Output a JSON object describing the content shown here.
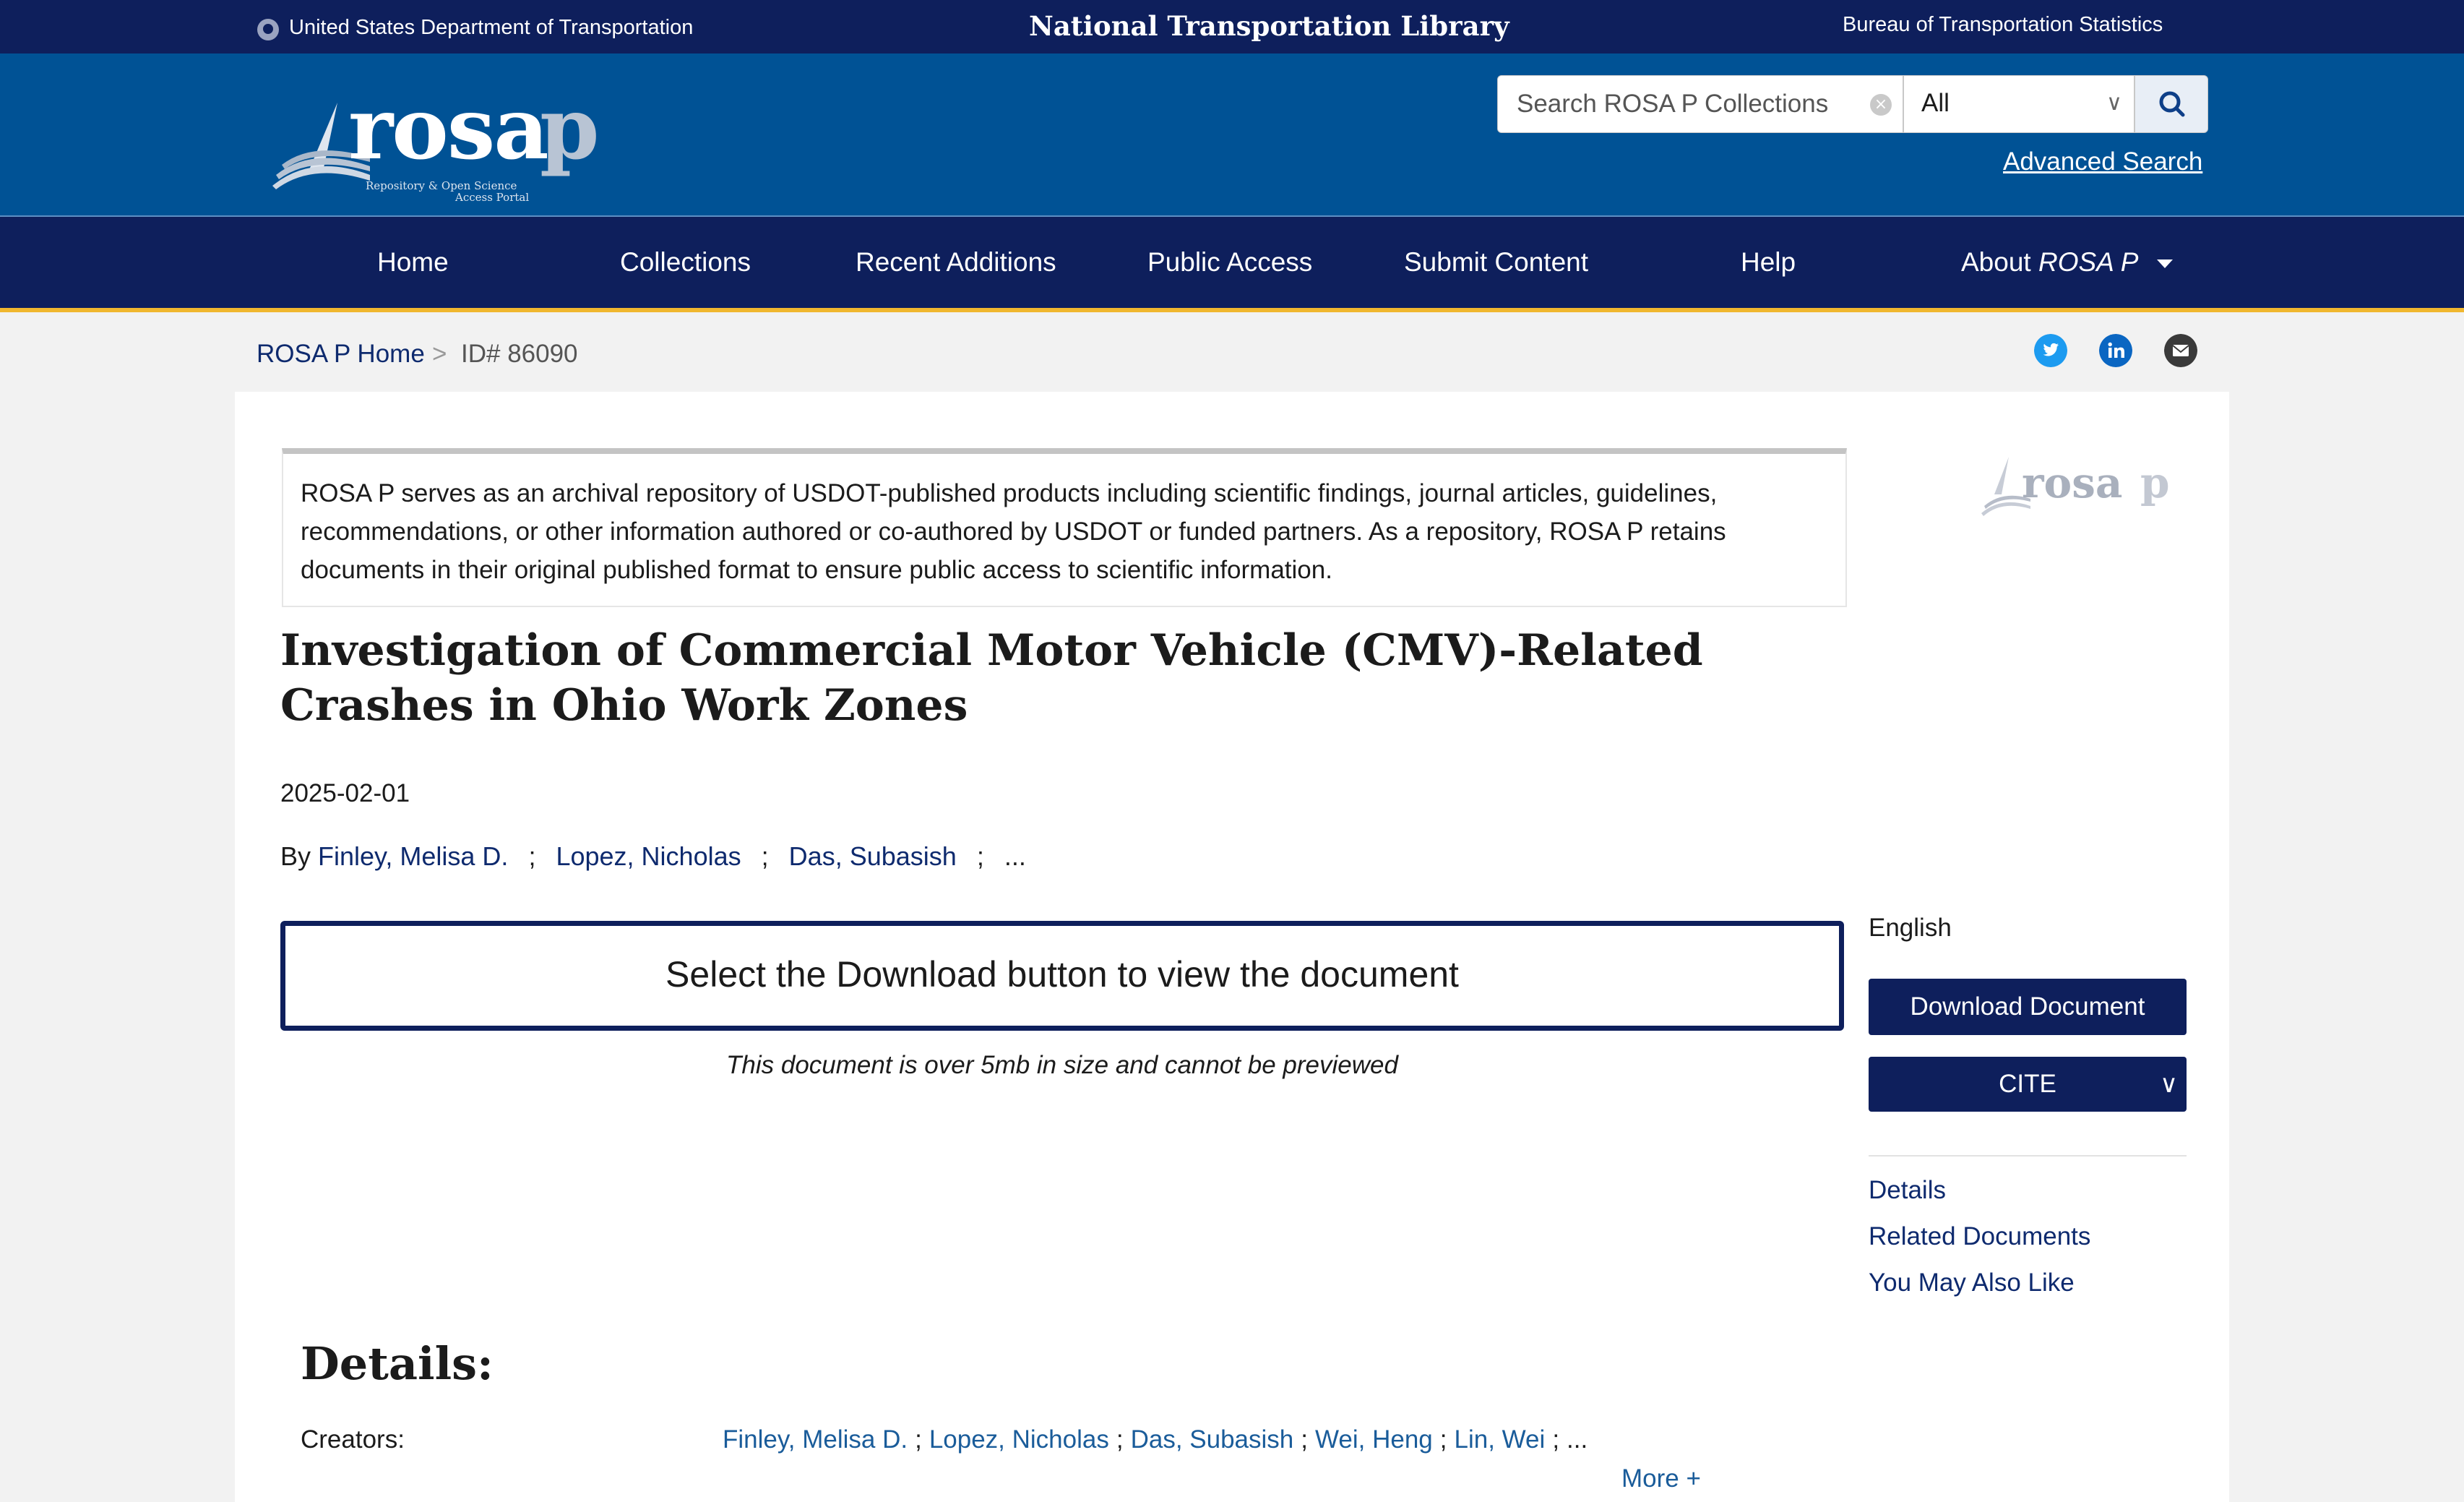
{
  "topbar": {
    "department": "United States Department of Transportation",
    "library": "National Transportation Library",
    "bureau": "Bureau of Transportation Statistics"
  },
  "logo": {
    "main": "rosa",
    "letter": "p",
    "sub_line1": "Repository & Open Science",
    "sub_line2": "Access Portal"
  },
  "search": {
    "placeholder": "Search ROSA P Collections",
    "scope_value": "All",
    "advanced_label": "Advanced Search"
  },
  "nav": {
    "home": "Home",
    "collections": "Collections",
    "recent": "Recent Additions",
    "public_access": "Public Access",
    "submit": "Submit Content",
    "help": "Help",
    "about_prefix": "About ",
    "about_name": "ROSA P"
  },
  "breadcrumb": {
    "home": "ROSA P Home",
    "separator": ">",
    "id": "ID# 86090"
  },
  "notice": "ROSA P serves as an archival repository of USDOT-published products including scientific findings, journal articles, guidelines, recommendations, or other information authored or co-authored by USDOT or funded partners. As a repository, ROSA P retains documents in their original published format to ensure public access to scientific information.",
  "document": {
    "title": "Investigation of Commercial Motor Vehicle (CMV)-Related Crashes in Ohio Work Zones",
    "date": "2025-02-01",
    "by": "By",
    "authors": [
      "Finley, Melisa D.",
      "Lopez, Nicholas",
      "Das, Subasish"
    ],
    "separator": ";",
    "ellipsis": "...",
    "preview_message": "Select the Download button to view the document",
    "preview_note": "This document is over 5mb in size and cannot be previewed"
  },
  "sidebar": {
    "language": "English",
    "download": "Download Document",
    "cite": "CITE",
    "links": [
      "Details",
      "Related Documents",
      "You May Also Like"
    ]
  },
  "details": {
    "heading": "Details:",
    "creators_label": "Creators:",
    "creators": [
      "Finley, Melisa D.",
      "Lopez, Nicholas",
      "Das, Subasish",
      "Wei, Heng",
      "Lin, Wei"
    ],
    "more": "More +"
  },
  "colors": {
    "navy": "#0e1f5c",
    "header_blue": "#005295",
    "accent_gold": "#f0b72f",
    "link": "#0e2a6e"
  }
}
